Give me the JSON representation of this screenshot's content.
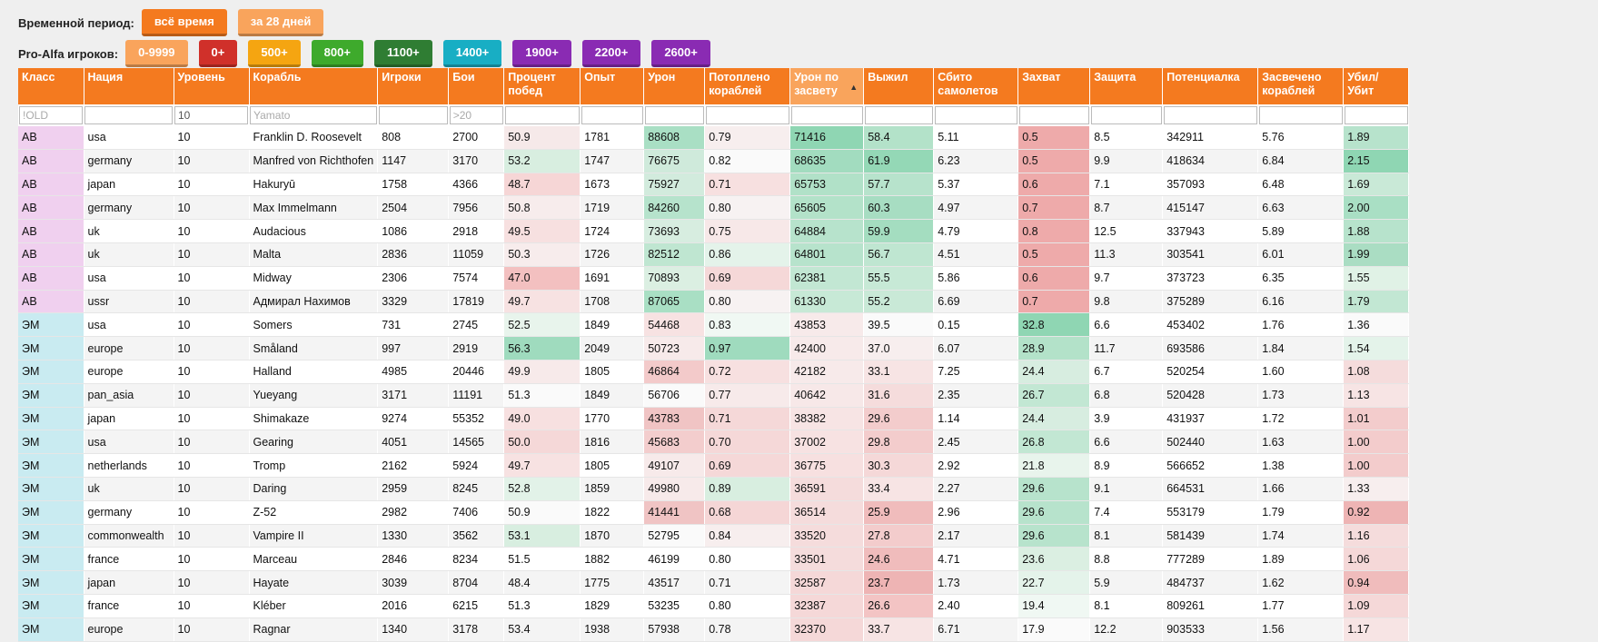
{
  "filters": {
    "period_label": "Временной период:",
    "period_buttons": [
      {
        "label": "всё время",
        "color": "#f47a1f"
      },
      {
        "label": "за 28 дней",
        "color": "#f9a45c"
      }
    ],
    "proalfa_label": "Pro-Alfa игроков:",
    "proalfa_buttons": [
      {
        "label": "0-9999",
        "color": "#f9a45c"
      },
      {
        "label": "0+",
        "color": "#d0302a"
      },
      {
        "label": "500+",
        "color": "#f5a511"
      },
      {
        "label": "800+",
        "color": "#3eaa2c"
      },
      {
        "label": "1100+",
        "color": "#2f7d33"
      },
      {
        "label": "1400+",
        "color": "#18aec4"
      },
      {
        "label": "1900+",
        "color": "#8a2bb3"
      },
      {
        "label": "2200+",
        "color": "#8a2bb3"
      },
      {
        "label": "2600+",
        "color": "#8a2bb3"
      }
    ]
  },
  "columns": [
    {
      "label": "Класс"
    },
    {
      "label": "Нация"
    },
    {
      "label": "Уровень"
    },
    {
      "label": "Корабль"
    },
    {
      "label": "Игроки"
    },
    {
      "label": "Бои"
    },
    {
      "label": "Процент побед"
    },
    {
      "label": "Опыт"
    },
    {
      "label": "Урон"
    },
    {
      "label": "Потоплено кораблей"
    },
    {
      "label": "Урон по засвету",
      "sorted": true
    },
    {
      "label": "Выжил"
    },
    {
      "label": "Сбито самолетов"
    },
    {
      "label": "Захват"
    },
    {
      "label": "Защита"
    },
    {
      "label": "Потенциалка"
    },
    {
      "label": "Засвечено кораблей"
    },
    {
      "label": "Убил/ Убит"
    }
  ],
  "filter_inputs": [
    {
      "value": "",
      "placeholder": "!OLD"
    },
    {
      "value": "",
      "placeholder": ""
    },
    {
      "value": "10",
      "placeholder": ""
    },
    {
      "value": "",
      "placeholder": "Yamato"
    },
    {
      "value": "",
      "placeholder": ""
    },
    {
      "value": "",
      "placeholder": ">20"
    },
    {
      "value": "",
      "placeholder": ""
    },
    {
      "value": "",
      "placeholder": ""
    },
    {
      "value": "",
      "placeholder": ""
    },
    {
      "value": "",
      "placeholder": ""
    },
    {
      "value": "",
      "placeholder": ""
    },
    {
      "value": "",
      "placeholder": ""
    },
    {
      "value": "",
      "placeholder": ""
    },
    {
      "value": "",
      "placeholder": ""
    },
    {
      "value": "",
      "placeholder": ""
    },
    {
      "value": "",
      "placeholder": ""
    },
    {
      "value": "",
      "placeholder": ""
    },
    {
      "value": "",
      "placeholder": ""
    }
  ],
  "rows": [
    [
      "АВ",
      "usa",
      "10",
      "Franklin D. Roosevelt",
      "808",
      "2700",
      "50.9",
      "1781",
      "88608",
      "0.79",
      "71416",
      "58.4",
      "5.11",
      "0.5",
      "8.5",
      "342911",
      "5.76",
      "1.89"
    ],
    [
      "АВ",
      "germany",
      "10",
      "Manfred von Richthofen",
      "1147",
      "3170",
      "53.2",
      "1747",
      "76675",
      "0.82",
      "68635",
      "61.9",
      "6.23",
      "0.5",
      "9.9",
      "418634",
      "6.84",
      "2.15"
    ],
    [
      "АВ",
      "japan",
      "10",
      "Hakuryū",
      "1758",
      "4366",
      "48.7",
      "1673",
      "75927",
      "0.71",
      "65753",
      "57.7",
      "5.37",
      "0.6",
      "7.1",
      "357093",
      "6.48",
      "1.69"
    ],
    [
      "АВ",
      "germany",
      "10",
      "Max Immelmann",
      "2504",
      "7956",
      "50.8",
      "1719",
      "84260",
      "0.80",
      "65605",
      "60.3",
      "4.97",
      "0.7",
      "8.7",
      "415147",
      "6.63",
      "2.00"
    ],
    [
      "АВ",
      "uk",
      "10",
      "Audacious",
      "1086",
      "2918",
      "49.5",
      "1724",
      "73693",
      "0.75",
      "64884",
      "59.9",
      "4.79",
      "0.8",
      "12.5",
      "337943",
      "5.89",
      "1.88"
    ],
    [
      "АВ",
      "uk",
      "10",
      "Malta",
      "2836",
      "11059",
      "50.3",
      "1726",
      "82512",
      "0.86",
      "64801",
      "56.7",
      "4.51",
      "0.5",
      "11.3",
      "303541",
      "6.01",
      "1.99"
    ],
    [
      "АВ",
      "usa",
      "10",
      "Midway",
      "2306",
      "7574",
      "47.0",
      "1691",
      "70893",
      "0.69",
      "62381",
      "55.5",
      "5.86",
      "0.6",
      "9.7",
      "373723",
      "6.35",
      "1.55"
    ],
    [
      "АВ",
      "ussr",
      "10",
      "Адмирал Нахимов",
      "3329",
      "17819",
      "49.7",
      "1708",
      "87065",
      "0.80",
      "61330",
      "55.2",
      "6.69",
      "0.7",
      "9.8",
      "375289",
      "6.16",
      "1.79"
    ],
    [
      "ЭМ",
      "usa",
      "10",
      "Somers",
      "731",
      "2745",
      "52.5",
      "1849",
      "54468",
      "0.83",
      "43853",
      "39.5",
      "0.15",
      "32.8",
      "6.6",
      "453402",
      "1.76",
      "1.36"
    ],
    [
      "ЭМ",
      "europe",
      "10",
      "Småland",
      "997",
      "2919",
      "56.3",
      "2049",
      "50723",
      "0.97",
      "42400",
      "37.0",
      "6.07",
      "28.9",
      "11.7",
      "693586",
      "1.84",
      "1.54"
    ],
    [
      "ЭМ",
      "europe",
      "10",
      "Halland",
      "4985",
      "20446",
      "49.9",
      "1805",
      "46864",
      "0.72",
      "42182",
      "33.1",
      "7.25",
      "24.4",
      "6.7",
      "520254",
      "1.60",
      "1.08"
    ],
    [
      "ЭМ",
      "pan_asia",
      "10",
      "Yueyang",
      "3171",
      "11191",
      "51.3",
      "1849",
      "56706",
      "0.77",
      "40642",
      "31.6",
      "2.35",
      "26.7",
      "6.8",
      "520428",
      "1.73",
      "1.13"
    ],
    [
      "ЭМ",
      "japan",
      "10",
      "Shimakaze",
      "9274",
      "55352",
      "49.0",
      "1770",
      "43783",
      "0.71",
      "38382",
      "29.6",
      "1.14",
      "24.4",
      "3.9",
      "431937",
      "1.72",
      "1.01"
    ],
    [
      "ЭМ",
      "usa",
      "10",
      "Gearing",
      "4051",
      "14565",
      "50.0",
      "1816",
      "45683",
      "0.70",
      "37002",
      "29.8",
      "2.45",
      "26.8",
      "6.6",
      "502440",
      "1.63",
      "1.00"
    ],
    [
      "ЭМ",
      "netherlands",
      "10",
      "Tromp",
      "2162",
      "5924",
      "49.7",
      "1805",
      "49107",
      "0.69",
      "36775",
      "30.3",
      "2.92",
      "21.8",
      "8.9",
      "566652",
      "1.38",
      "1.00"
    ],
    [
      "ЭМ",
      "uk",
      "10",
      "Daring",
      "2959",
      "8245",
      "52.8",
      "1859",
      "49980",
      "0.89",
      "36591",
      "33.4",
      "2.27",
      "29.6",
      "9.1",
      "664531",
      "1.66",
      "1.33"
    ],
    [
      "ЭМ",
      "germany",
      "10",
      "Z-52",
      "2982",
      "7406",
      "50.9",
      "1822",
      "41441",
      "0.68",
      "36514",
      "25.9",
      "2.96",
      "29.6",
      "7.4",
      "553179",
      "1.79",
      "0.92"
    ],
    [
      "ЭМ",
      "commonwealth",
      "10",
      "Vampire II",
      "1330",
      "3562",
      "53.1",
      "1870",
      "52795",
      "0.84",
      "33520",
      "27.8",
      "2.17",
      "29.6",
      "8.1",
      "581439",
      "1.74",
      "1.16"
    ],
    [
      "ЭМ",
      "france",
      "10",
      "Marceau",
      "2846",
      "8234",
      "51.5",
      "1882",
      "46199",
      "0.80",
      "33501",
      "24.6",
      "4.71",
      "23.6",
      "8.8",
      "777289",
      "1.89",
      "1.06"
    ],
    [
      "ЭМ",
      "japan",
      "10",
      "Hayate",
      "3039",
      "8704",
      "48.4",
      "1775",
      "43517",
      "0.71",
      "32587",
      "23.7",
      "1.73",
      "22.7",
      "5.9",
      "484737",
      "1.62",
      "0.94"
    ],
    [
      "ЭМ",
      "france",
      "10",
      "Kléber",
      "2016",
      "6215",
      "51.3",
      "1829",
      "53235",
      "0.80",
      "32387",
      "26.6",
      "2.40",
      "19.4",
      "8.1",
      "809261",
      "1.77",
      "1.09"
    ],
    [
      "ЭМ",
      "europe",
      "10",
      "Ragnar",
      "1340",
      "3178",
      "53.4",
      "1938",
      "57938",
      "0.78",
      "32370",
      "33.7",
      "6.71",
      "17.9",
      "12.2",
      "903533",
      "1.56",
      "1.17"
    ]
  ],
  "cell_colors": {
    "6": [
      "#f6e9e9",
      "#d8eee0",
      "#f6d6d6",
      "#f7ecec",
      "#f7e0e0",
      "#f7ecec",
      "#f3c0c0",
      "#f7e2e2",
      "#e8f4ec",
      "#9fdbbe",
      "#f7eaea",
      "#fafafa",
      "#f7e0e0",
      "#f5d8d8",
      "#f7e2e2",
      "#e2f2e8",
      "#fafafa",
      "#d8eee0"
    ],
    "8": [
      "#a9dfc4",
      "#cfeadb",
      "#d2ebdd",
      "#b6e3cc",
      "#d7ede0",
      "#bfe6d1",
      "#dbefe2",
      "#a9dfc4",
      "#f7e2e2",
      "#f7eaea",
      "#f3caca",
      "#fafafa",
      "#f0c4c4",
      "#f3cdcd",
      "#f7eaea",
      "#f7eaea",
      "#f0c4c4",
      "#fafafa"
    ],
    "9": [
      "#f7eeee",
      "#fafafa",
      "#f7e0e0",
      "#f7f2f2",
      "#f7e8e8",
      "#e4f3ea",
      "#f5d8d8",
      "#f7f2f2",
      "#f0f8f3",
      "#9fdbbe",
      "#f7e0e0",
      "#f7eaea",
      "#f5d8d8",
      "#f5d8d8",
      "#f5d8d8",
      "#d8eee0",
      "#f5d6d6",
      "#f7eeee"
    ],
    "10": [
      "#8fd6b3",
      "#a2dcbf",
      "#b1e1c8",
      "#b3e2c9",
      "#b7e3cc",
      "#b7e3cc",
      "#c2e7d3",
      "#c7e9d6",
      "#f7eaea",
      "#f7eaea",
      "#f7eaea",
      "#f7e8e8",
      "#f7e4e4",
      "#f7e2e2",
      "#f7e0e0",
      "#f5dcdc",
      "#f5dcdc",
      "#f5dcdc",
      "#f5dcdc",
      "#f5d8d8",
      "#f5d8d8",
      "#f5d8d8"
    ],
    "11": [
      "#b3e2c9",
      "#94d8b6",
      "#b7e3cc",
      "#a7ddc2",
      "#a4ddc0",
      "#bfe6d1",
      "#c7e9d6",
      "#c9e9d7",
      "#fafafa",
      "#f7eeee",
      "#f7e4e4",
      "#f5dcdc",
      "#f3cccc",
      "#f3cccc",
      "#f5d8d8",
      "#f7e4e4",
      "#f0bcbc",
      "#f3cccc",
      "#f0bcbc",
      "#eeb4b4",
      "#f3c4c4",
      "#f7e4e4"
    ],
    "13": [
      "#eeaaaa",
      "#eeaaaa",
      "#eeaaaa",
      "#eeaaaa",
      "#eeaaaa",
      "#eeaaaa",
      "#eeaaaa",
      "#eeaaaa",
      "#8fd6b3",
      "#b3e2c9",
      "#d7ede0",
      "#c2e7d3",
      "#d7ede0",
      "#c2e7d3",
      "#e8f4ec",
      "#b7e3cc",
      "#b7e3cc",
      "#b7e3cc",
      "#dbefe2",
      "#e4f3ea",
      "#f0f8f3",
      "#fafafa"
    ],
    "17": [
      "#b7e3cc",
      "#8fd6b3",
      "#c9e9d7",
      "#a9dfc4",
      "#b7e3cc",
      "#aaddc3",
      "#e0f2e6",
      "#c2e7d3",
      "#fafafa",
      "#e4f3ea",
      "#f5dcdc",
      "#f7e4e4",
      "#f3cccc",
      "#f3cccc",
      "#f3cccc",
      "#f7eeee",
      "#eeb4b4",
      "#f5dcdc",
      "#f5d8d8",
      "#f0bcbc",
      "#f5d8d8",
      "#f7e4e4"
    ]
  }
}
